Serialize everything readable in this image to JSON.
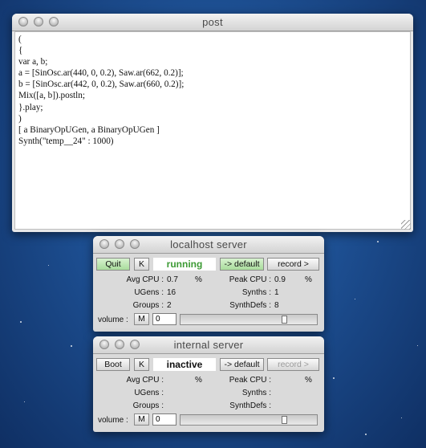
{
  "post": {
    "title": "post",
    "lines": [
      "(",
      "{",
      "var a, b;",
      "a = [SinOsc.ar(440, 0, 0.2), Saw.ar(662, 0.2)];",
      "b = [SinOsc.ar(442, 0, 0.2), Saw.ar(660, 0.2)];",
      "Mix([a, b]).postln;",
      "}.play;",
      ")",
      "[ a BinaryOpUGen, a BinaryOpUGen ]",
      "Synth(\"temp__24\" : 1000)"
    ]
  },
  "localhost": {
    "title": "localhost server",
    "quit_label": "Quit",
    "k_label": "K",
    "status": "running",
    "status_color": "#3c9a34",
    "default_label": "-> default",
    "record_label": "record >",
    "avg_cpu_label": "Avg CPU :",
    "avg_cpu_value": "0.7",
    "percent1": "%",
    "peak_cpu_label": "Peak CPU :",
    "peak_cpu_value": "0.9",
    "percent2": "%",
    "ugens_label": "UGens :",
    "ugens_value": "16",
    "synths_label": "Synths :",
    "synths_value": "1",
    "groups_label": "Groups :",
    "groups_value": "2",
    "synthdefs_label": "SynthDefs :",
    "synthdefs_value": "8",
    "volume_label": "volume :",
    "m_label": "M",
    "volume_value": "0",
    "volume_level": 0.78
  },
  "internal": {
    "title": "internal server",
    "boot_label": "Boot",
    "k_label": "K",
    "status": "inactive",
    "status_color": "#111111",
    "default_label": "-> default",
    "record_label": "record >",
    "avg_cpu_label": "Avg CPU :",
    "percent1": "%",
    "peak_cpu_label": "Peak CPU :",
    "percent2": "%",
    "ugens_label": "UGens :",
    "synths_label": "Synths :",
    "groups_label": "Groups :",
    "synthdefs_label": "SynthDefs :",
    "volume_label": "volume :",
    "m_label": "M",
    "volume_value": "0",
    "volume_level": 0.78
  }
}
